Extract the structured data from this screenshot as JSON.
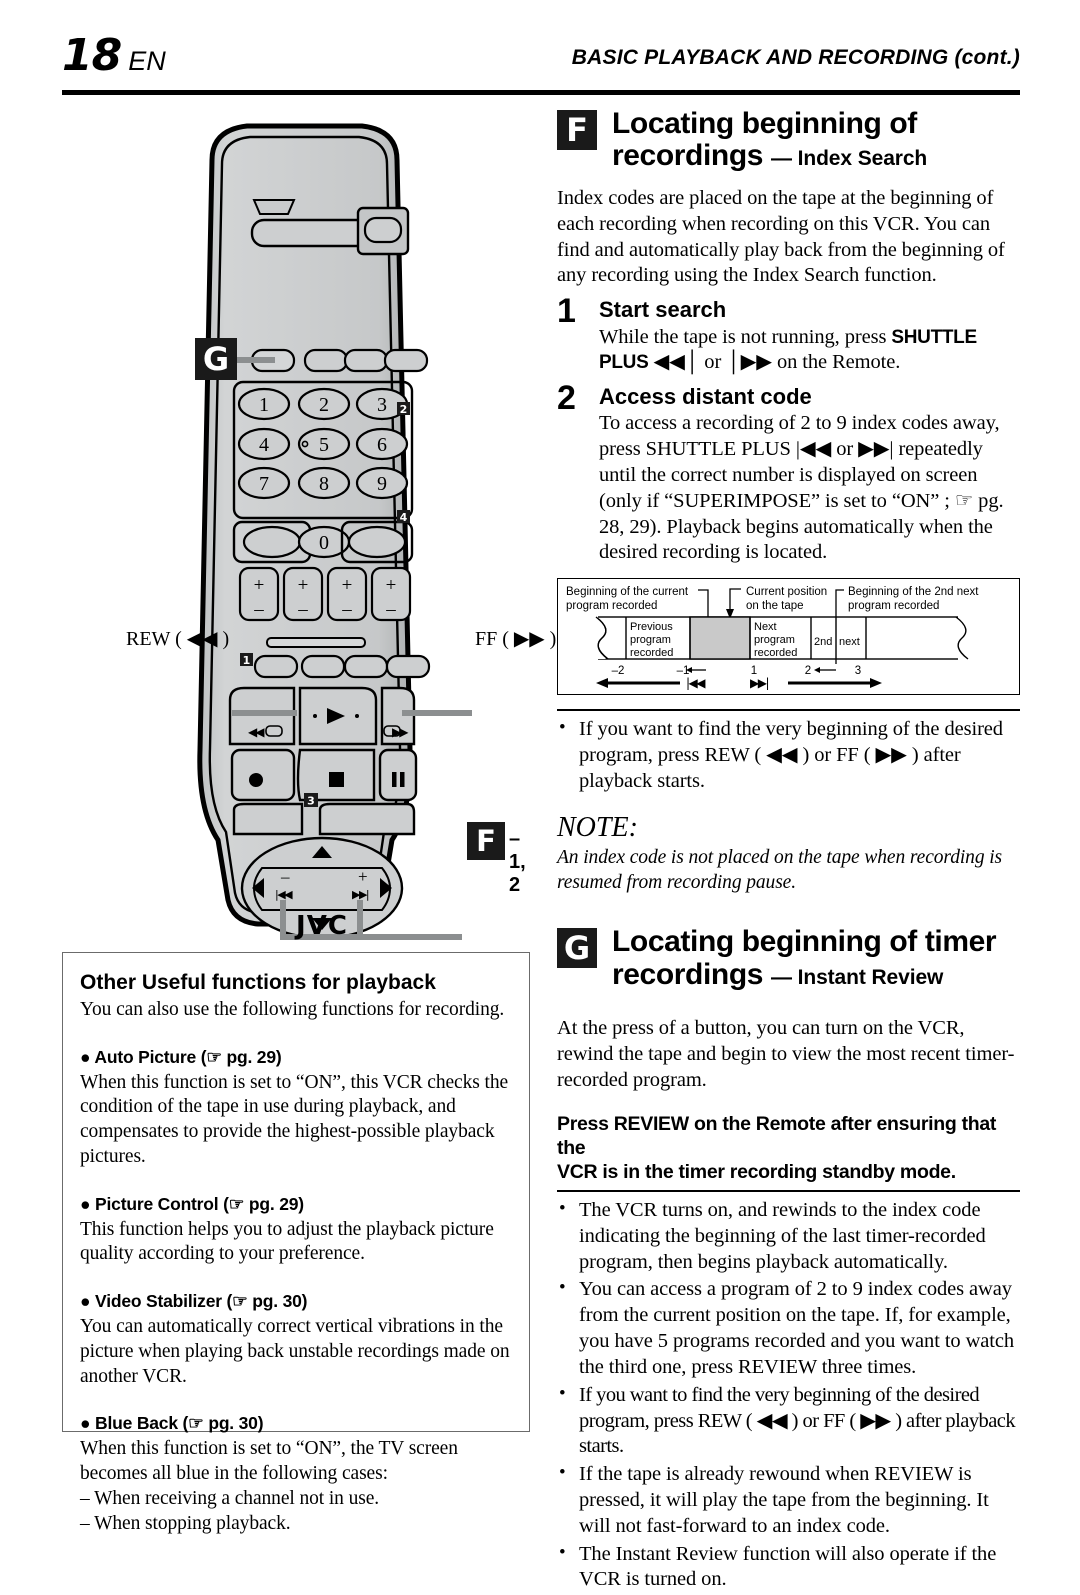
{
  "header": {
    "page_number": "18",
    "lang": "EN",
    "title": "BASIC PLAYBACK AND RECORDING (cont.)"
  },
  "remote_callouts": {
    "badge_g": "G",
    "badge_f": "F",
    "badge_f_suffix": "–1, 2",
    "rew_label": "REW ( ◀◀ )",
    "ff_label": "FF ( ▶▶ )",
    "brand": "JVC",
    "keypad": [
      "1",
      "2",
      "3",
      "4",
      "5",
      "6",
      "7",
      "8",
      "9",
      "0"
    ],
    "markers": [
      "1",
      "2",
      "3",
      "4"
    ],
    "plus": "+",
    "minus": "–"
  },
  "section_f": {
    "badge": "F",
    "title_line1": "Locating beginning of",
    "title_line2": "recordings",
    "title_sub": "— Index Search",
    "intro": "Index codes are placed on the tape at the beginning of each recording when recording on this VCR. You can find and automatically play back from the beginning of any recording using the Index Search function.",
    "steps": [
      {
        "number": "1",
        "title": "Start search",
        "body_pre": "While the tape is not running, press ",
        "bold": "SHUTTLE PLUS",
        "body_post": " ◀◀│ or │▶▶ on the Remote."
      },
      {
        "number": "2",
        "title": "Access distant code",
        "body": "To access a recording of 2 to 9 index codes away, press SHUTTLE PLUS |◀◀ or ▶▶| repeatedly until the correct number is displayed on screen (only if “SUPERIMPOSE” is set to “ON” ; ☞ pg. 28, 29). Playback begins automatically when the desired recording is located."
      }
    ],
    "bullet": "If you want to find the very beginning of the desired program, press REW ( ◀◀ ) or FF ( ▶▶ ) after playback starts.",
    "note_heading": "NOTE:",
    "note_text": "An index code is not placed on the tape when recording is resumed from recording pause."
  },
  "diagram": {
    "label_current_begin_l1": "Beginning of the current",
    "label_current_begin_l2": "program recorded",
    "label_position_l1": "Current position",
    "label_position_l2": "on the tape",
    "label_2nd_next_l1": "Beginning of the 2nd next",
    "label_2nd_next_l2": "program recorded",
    "block_prev": [
      "Previous",
      "program",
      "recorded"
    ],
    "block_next": [
      "Next",
      "program",
      "recorded"
    ],
    "block_2nd": "2nd",
    "block_next_short": "next",
    "scale": [
      "–2",
      "–1",
      "1",
      "2",
      "3"
    ],
    "icon_rew": "|◀◀",
    "icon_ff": "▶▶|"
  },
  "section_g": {
    "badge": "G",
    "title_line1": "Locating beginning of timer",
    "title_line2": "recordings",
    "title_sub": "— Instant Review",
    "intro": "At the press of a button, you can turn on the VCR, rewind the tape and begin to view the most recent timer-recorded program.",
    "leadin_l1": "Press REVIEW on the Remote after ensuring that the",
    "leadin_l2": "VCR is in the timer recording standby mode.",
    "bullets": [
      "The VCR turns on, and rewinds to the index code indicating the beginning of the last timer-recorded program, then begins playback automatically.",
      "You can access a program of 2 to 9 index codes away from the current position on the tape. If, for example, you have 5 programs recorded and you want to watch the third one, press REVIEW three times.",
      "If you want to find the very beginning of the desired program, press REW ( ◀◀ ) or FF ( ▶▶ ) after playback starts.",
      "If the tape is already rewound when REVIEW is pressed, it will play the tape from the beginning. It will not fast-forward to an index code.",
      "The Instant Review function will also operate if the VCR is turned on."
    ]
  },
  "info_box": {
    "title": "Other Useful functions for playback",
    "lead": "You can also use the following functions for recording.",
    "items": [
      {
        "name": "Auto Picture",
        "page_ref": "(☞ pg. 29)",
        "body": "When this function is set to “ON”, this VCR checks the condition of the tape in use during playback, and compensates to provide the highest-possible playback pictures."
      },
      {
        "name": "Picture Control",
        "page_ref": "(☞ pg. 29)",
        "body": "This function helps you to adjust the playback picture quality according to your preference."
      },
      {
        "name": "Video Stabilizer",
        "page_ref": "(☞ pg. 30)",
        "body": "You can automatically correct vertical vibrations in the picture when playing back unstable recordings made on another VCR."
      },
      {
        "name": "Blue Back",
        "page_ref": "(☞ pg. 30)",
        "body": "When this function is set to “ON”, the TV screen becomes all blue in the following cases:",
        "sub_lines": [
          "– When receiving a channel not in use.",
          "– When stopping playback."
        ]
      }
    ]
  },
  "colors": {
    "ink": "#000000",
    "badge_bg": "#1a1a1a",
    "box_border": "#6b6b6b",
    "remote_body": "#c9cbcc",
    "remote_shade": "#b4b7b8",
    "diagram_fill": "#c9c9c9"
  }
}
